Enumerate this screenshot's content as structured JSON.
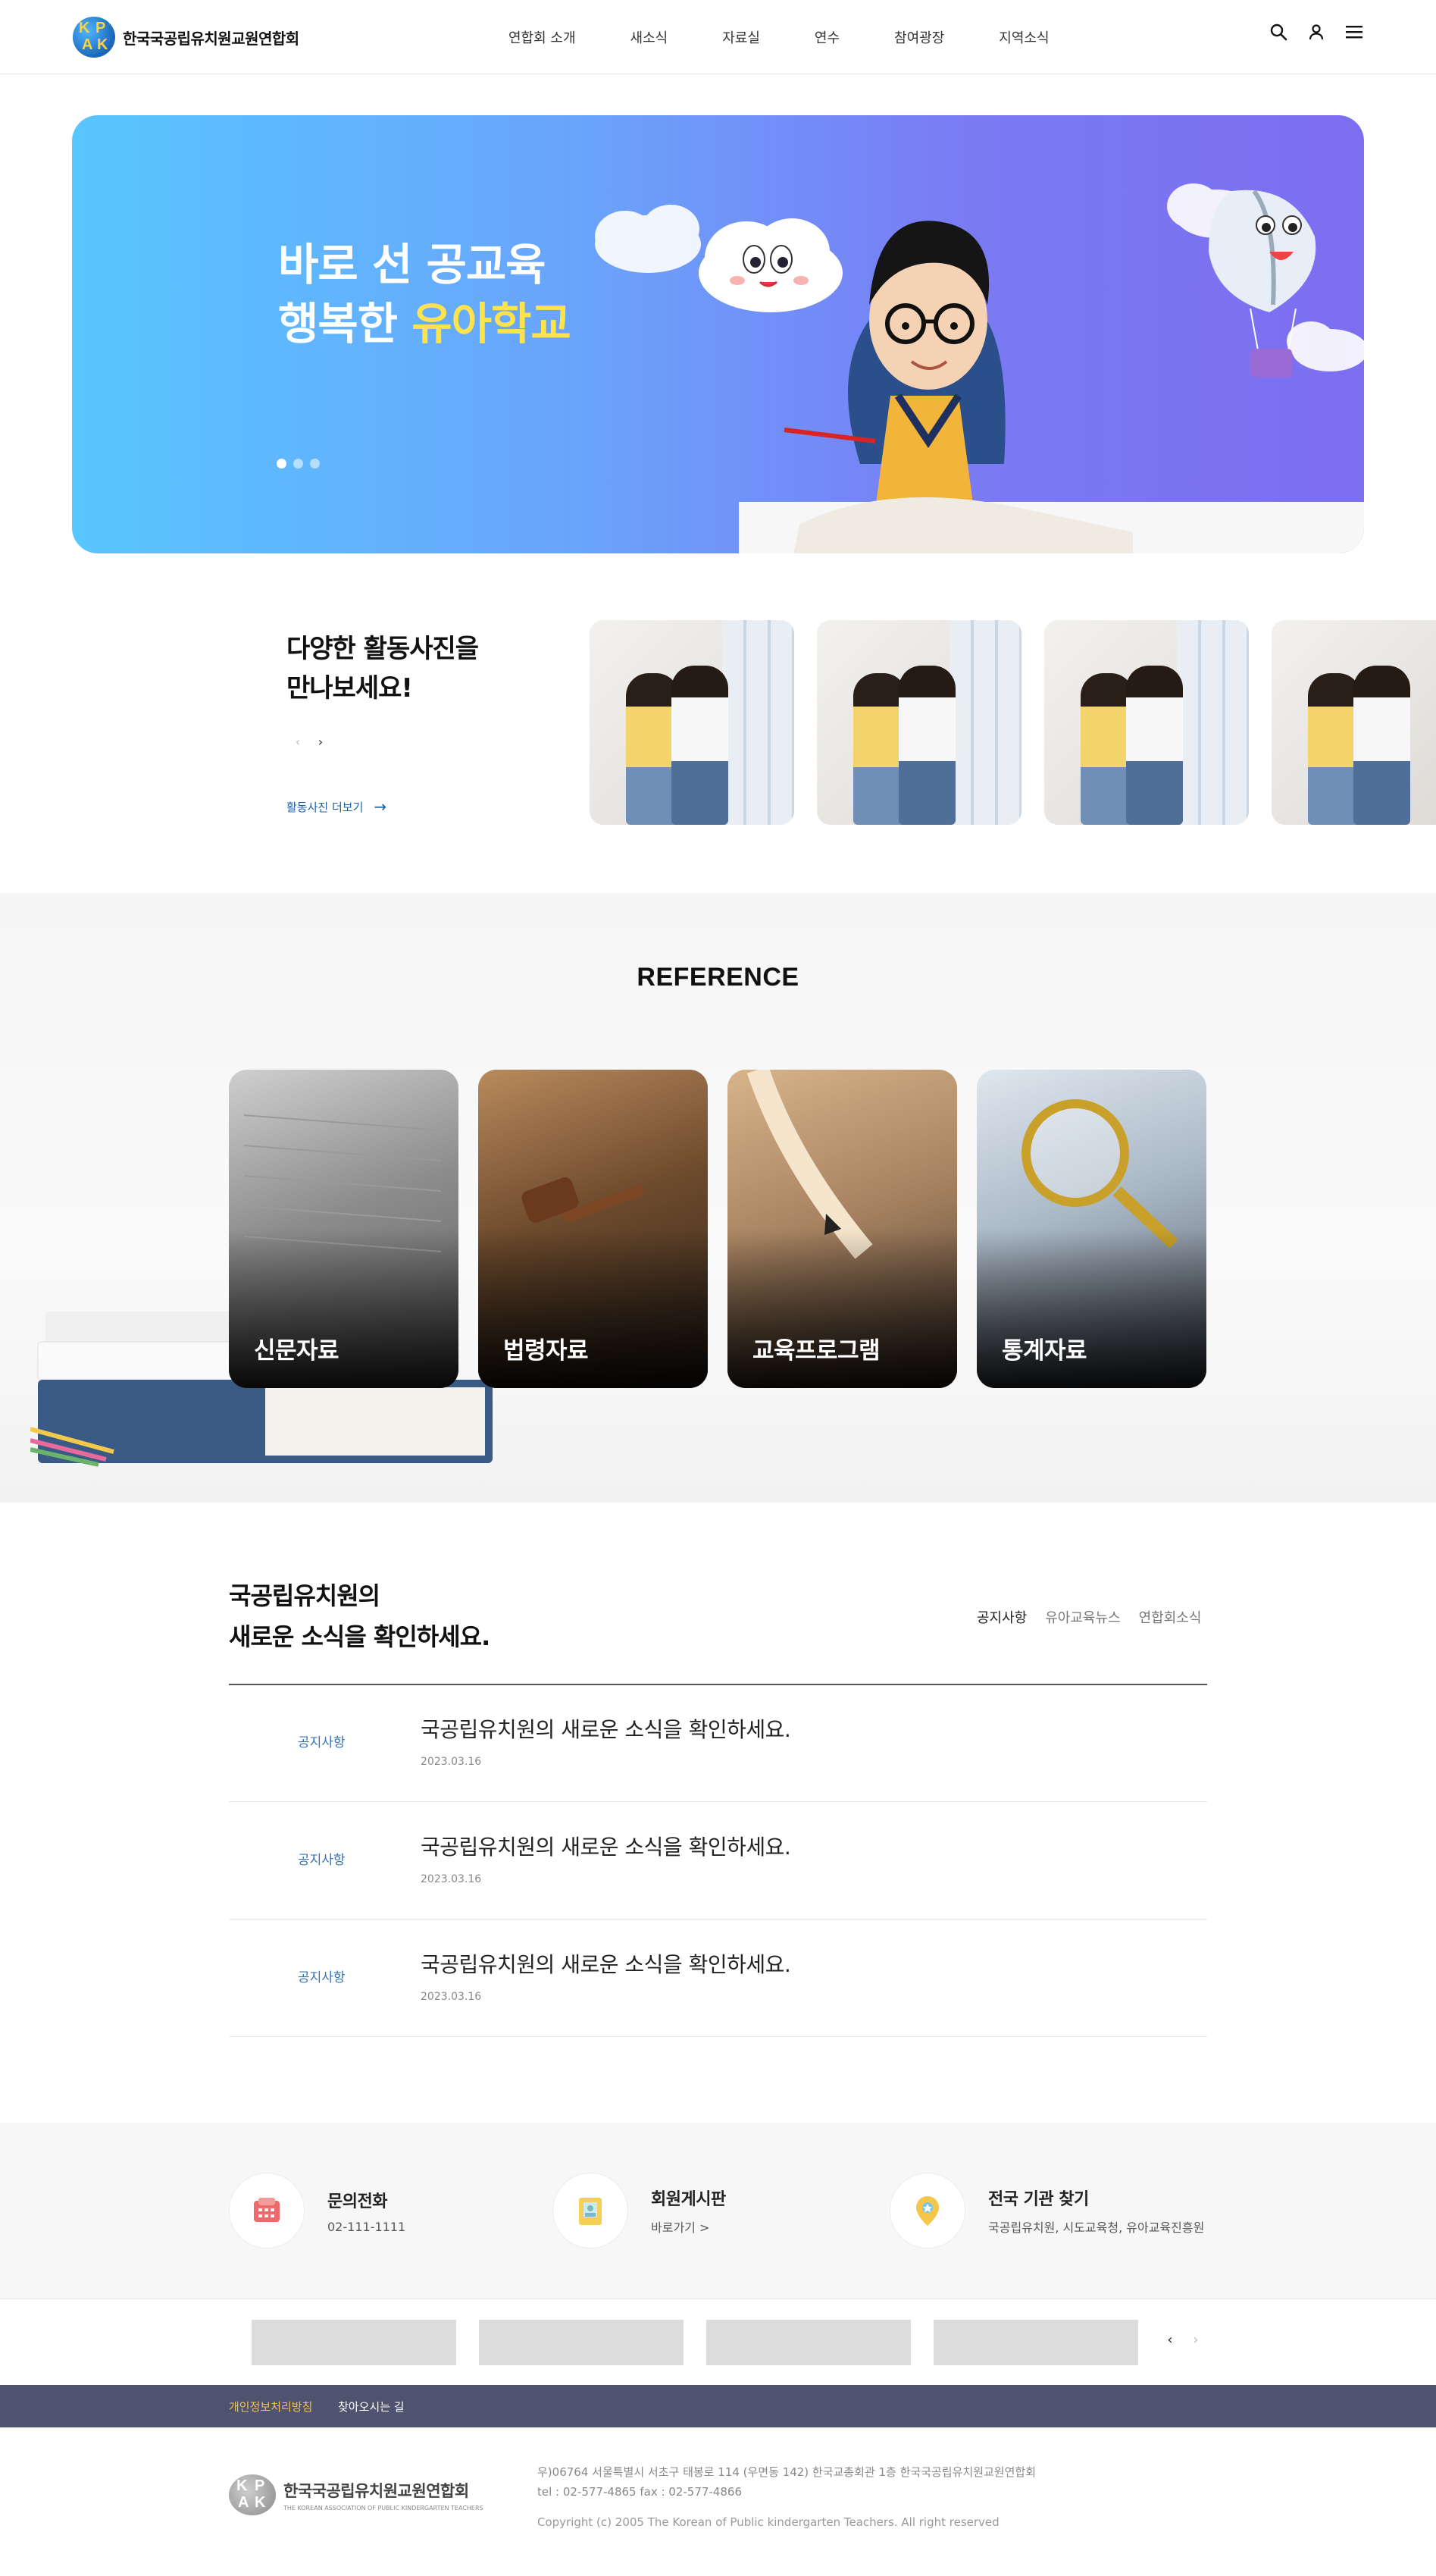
{
  "header": {
    "logo_text": "한국국공립유치원교원연합회",
    "nav": [
      "연합회 소개",
      "새소식",
      "자료실",
      "연수",
      "참여광장",
      "지역소식"
    ]
  },
  "hero": {
    "line1": "바로 선 공교육",
    "line2_prefix": "행복한",
    "line2_highlight": "유아학교",
    "slide_count": 3,
    "active_slide": 1
  },
  "activity": {
    "title_line1": "다양한 활동사진을",
    "title_line2": "만나보세요!",
    "prev": "‹",
    "next": "›",
    "more": "활동사진 더보기",
    "more_arrow": "→"
  },
  "reference": {
    "title": "REFERENCE",
    "cards": [
      "신문자료",
      "법령자료",
      "교육프로그램",
      "통계자료"
    ]
  },
  "news": {
    "title_line1": "국공립유치원의",
    "title_line2": "새로운 소식을 확인하세요.",
    "tabs": [
      "공지사항",
      "유아교육뉴스",
      "연합회소식"
    ],
    "items": [
      {
        "category": "공지사항",
        "title": "국공립유치원의 새로운 소식을 확인하세요.",
        "date": "2023.03.16"
      },
      {
        "category": "공지사항",
        "title": "국공립유치원의 새로운 소식을 확인하세요.",
        "date": "2023.03.16"
      },
      {
        "category": "공지사항",
        "title": "국공립유치원의 새로운 소식을 확인하세요.",
        "date": "2023.03.16"
      }
    ]
  },
  "quick": {
    "items": [
      {
        "name": "문의전화",
        "sub": "02-111-1111"
      },
      {
        "name": "회원게시판",
        "sub": "바로가기 >"
      },
      {
        "name": "전국 기관 찾기",
        "sub": "국공립유치원, 시도교육청, 유아교육진흥원"
      }
    ]
  },
  "banners": {
    "prev": "‹",
    "next": "›"
  },
  "footer": {
    "link_privacy": "개인정보처리방침",
    "link_directions": "찾아오시는 길",
    "org_name": "한국국공립유치원교원연합회",
    "org_name_en": "THE KOREAN ASSOCIATION OF PUBLIC KINDERGARTEN TEACHERS",
    "address": "우)06764 서울특별시 서초구 태봉로 114 (우면동 142) 한국교총회관 1층 한국국공립유치원교원연합회",
    "contact": "tel : 02-577-4865 fax : 02-577-4866",
    "copyright": "Copyright (c) 2005 The Korean of Public kindergarten Teachers. All right reserved"
  },
  "colors": {
    "accent_blue": "#3873b8",
    "highlight_yellow": "#ffe34a",
    "footer_bar": "#4e536f"
  }
}
